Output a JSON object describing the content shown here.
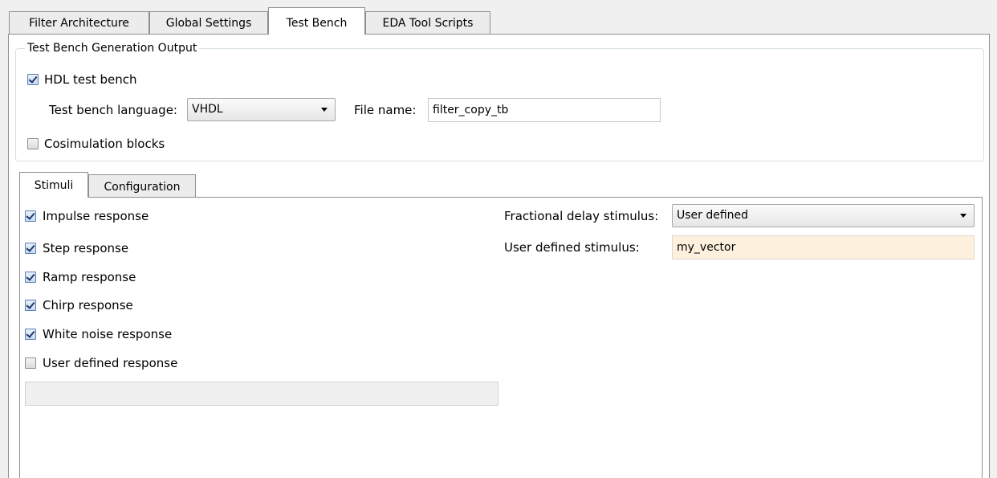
{
  "tabs": [
    "Filter Architecture",
    "Global Settings",
    "Test Bench",
    "EDA Tool Scripts"
  ],
  "group": {
    "title": "Test Bench Generation Output",
    "hdl_test_bench": {
      "label": "HDL test bench",
      "checked": true
    },
    "language": {
      "label": "Test bench language:",
      "value": "VHDL"
    },
    "file_name": {
      "label": "File name:",
      "value": "filter_copy_tb"
    },
    "cosimulation": {
      "label": "Cosimulation blocks",
      "checked": false
    }
  },
  "inner_tabs": [
    "Stimuli",
    "Configuration"
  ],
  "stimuli": [
    {
      "label": "Impulse response",
      "checked": true
    },
    {
      "label": "Step response",
      "checked": true
    },
    {
      "label": "Ramp response",
      "checked": true
    },
    {
      "label": "Chirp response",
      "checked": true
    },
    {
      "label": "White noise response",
      "checked": true
    },
    {
      "label": "User defined response",
      "checked": false
    }
  ],
  "user_defined_response_field": {
    "value": "",
    "enabled": false
  },
  "fractional_delay": {
    "label": "Fractional delay stimulus:",
    "value": "User defined"
  },
  "user_defined_stimulus": {
    "label": "User defined stimulus:",
    "value": "my_vector"
  },
  "colors": {
    "highlight_field": "#fdf1de",
    "checkbox_check": "#21366a",
    "panel_bg": "#ffffff",
    "window_bg": "#f0f0f0"
  }
}
